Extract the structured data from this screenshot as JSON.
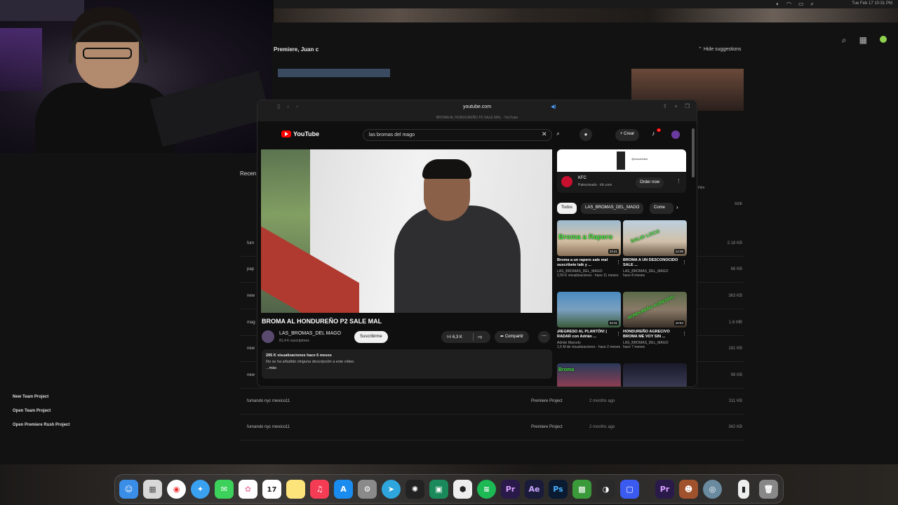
{
  "menubar": {
    "clock": "Tue Feb 17 10:31 PM"
  },
  "premiere": {
    "heading": "Premiere, Juan c",
    "hide_suggestions": "Hide suggestions",
    "recent_label": "Recen",
    "col_size": "SIZE",
    "col_film": "Film",
    "rows": [
      {
        "name": "fum",
        "type": "",
        "date": "",
        "size": "2.18 KB"
      },
      {
        "name": "pap",
        "type": "",
        "date": "",
        "size": "86 KB"
      },
      {
        "name": "new",
        "type": "",
        "date": "",
        "size": "363 KB"
      },
      {
        "name": "mag",
        "type": "",
        "date": "",
        "size": "1.6 MB"
      },
      {
        "name": "new",
        "type": "",
        "date": "",
        "size": "181 KB"
      },
      {
        "name": "new",
        "type": "",
        "date": "",
        "size": "98 KB"
      },
      {
        "name": "fumando nyc mexico11",
        "type": "Premiere Project",
        "date": "2 months ago",
        "size": "311 KB"
      },
      {
        "name": "fumando nyc mexico11",
        "type": "Premiere Project",
        "date": "2 months ago",
        "size": "342 KB"
      }
    ],
    "left_links": [
      "New Team Project",
      "Open Team Project",
      "Open Premiere Rush Project"
    ]
  },
  "safari": {
    "url": "youtube.com",
    "tab_title": "BROMA AL HONDUREÑO P2 SALE MAL - YouTube"
  },
  "youtube": {
    "logo": "YouTube",
    "search_query": "las bromas del mago",
    "create_label": "Crear",
    "notif_count": "9",
    "video": {
      "title": "BROMA AL HONDUREÑO P2 SALE MAL",
      "channel": "LAS_BROMAS_DEL MAGO",
      "subscribers": "81,4 K suscriptores",
      "subscribe_label": "Suscribirme",
      "likes": "6,3 K",
      "share_label": "Compartir",
      "views_line": "295 K visualizaciones  hace 6 meses",
      "no_desc": "No se ha añadido ninguna descripción a este vídeo.",
      "more": "...más"
    },
    "ad": {
      "brand": "KFC",
      "sponsored": "Patrocinado · kfc.com",
      "cta": "Order now",
      "banner_text": "@snackfrank"
    },
    "chips": [
      "Todos",
      "LAS_BROMAS_DEL_MAGO",
      "Come"
    ],
    "recommendations": [
      {
        "title": "Broma a un rapero sale mal suscribete laik y ...",
        "channel": "LAS_BROMAS_DEL_MAGO",
        "meta": "2,50 K visualizaciones · hace 11 meses",
        "duration": "23:41",
        "overlay": "Broma a Rapero"
      },
      {
        "title": "BROMA A UN DESCONOCIDO SALE ...",
        "channel": "LAS_BROMAS_DEL_MAGO",
        "meta": "hace 8 meses",
        "duration": "24:05",
        "overlay": "SALIO LOCO"
      },
      {
        "title": "¡REGRESO AL PLANTÓN! | RADAR con Adrián ...",
        "channel": "Adrián Marcelo",
        "meta": "1,6 M de visualizaciones · hace 2 meses",
        "duration": "34:31",
        "overlay": ""
      },
      {
        "title": "HONDUREÑO AGRECIVO BROMA ME VOY SIN ...",
        "channel": "LAS_BROMAS_DEL_MAGO",
        "meta": "hace 7 meses",
        "duration": "10:54",
        "overlay": "HONDUREÑO AGRESIVO"
      },
      {
        "title": "",
        "channel": "",
        "meta": "",
        "duration": "",
        "overlay": "Broma"
      },
      {
        "title": "",
        "channel": "",
        "meta": "",
        "duration": "",
        "overlay": ""
      }
    ]
  },
  "dock": {
    "apps": [
      "Finder",
      "Launchpad",
      "Chrome",
      "Safari",
      "Messages",
      "Photos",
      "Calendar",
      "Notes",
      "Music",
      "App Store",
      "System Settings",
      "Telegram",
      "ChatGPT",
      "Copilot",
      "Blender",
      "Spotify",
      "Premiere Pro",
      "After Effects",
      "Photoshop",
      "Minecraft",
      "Steam",
      "Xcode",
      "Premiere Pro",
      "Game",
      "Preview",
      "File",
      "Trash"
    ],
    "calendar_day": "17",
    "calendar_month": "FEB"
  }
}
